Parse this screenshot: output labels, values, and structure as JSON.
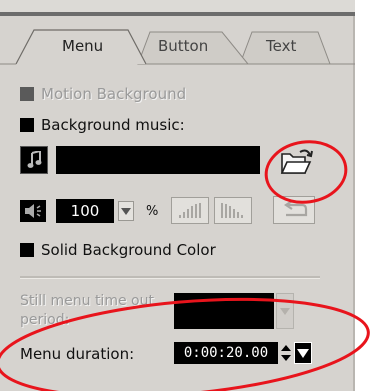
{
  "tabs": [
    {
      "label": "Menu",
      "active": true
    },
    {
      "label": "Button",
      "active": false
    },
    {
      "label": "Text",
      "active": false
    }
  ],
  "options": {
    "motion_background": "Motion Background",
    "background_music": "Background music:",
    "solid_background_color": "Solid Background Color"
  },
  "audio": {
    "volume": "100",
    "percent_sign": "%"
  },
  "timing": {
    "still_menu_label": "Still menu time out period:",
    "menu_duration_label": "Menu duration:",
    "menu_duration_value": "0:00:20.00"
  },
  "icons": [
    "music-note-icon",
    "open-folder-icon",
    "speaker-icon",
    "equalizer-icon",
    "undo-icon",
    "dropdown-arrow-icon",
    "spinner-arrows-icon"
  ],
  "colors": {
    "panel": "#d6d3cf",
    "annotation_ellipse": "#e8141c",
    "field_background": "#000000"
  }
}
